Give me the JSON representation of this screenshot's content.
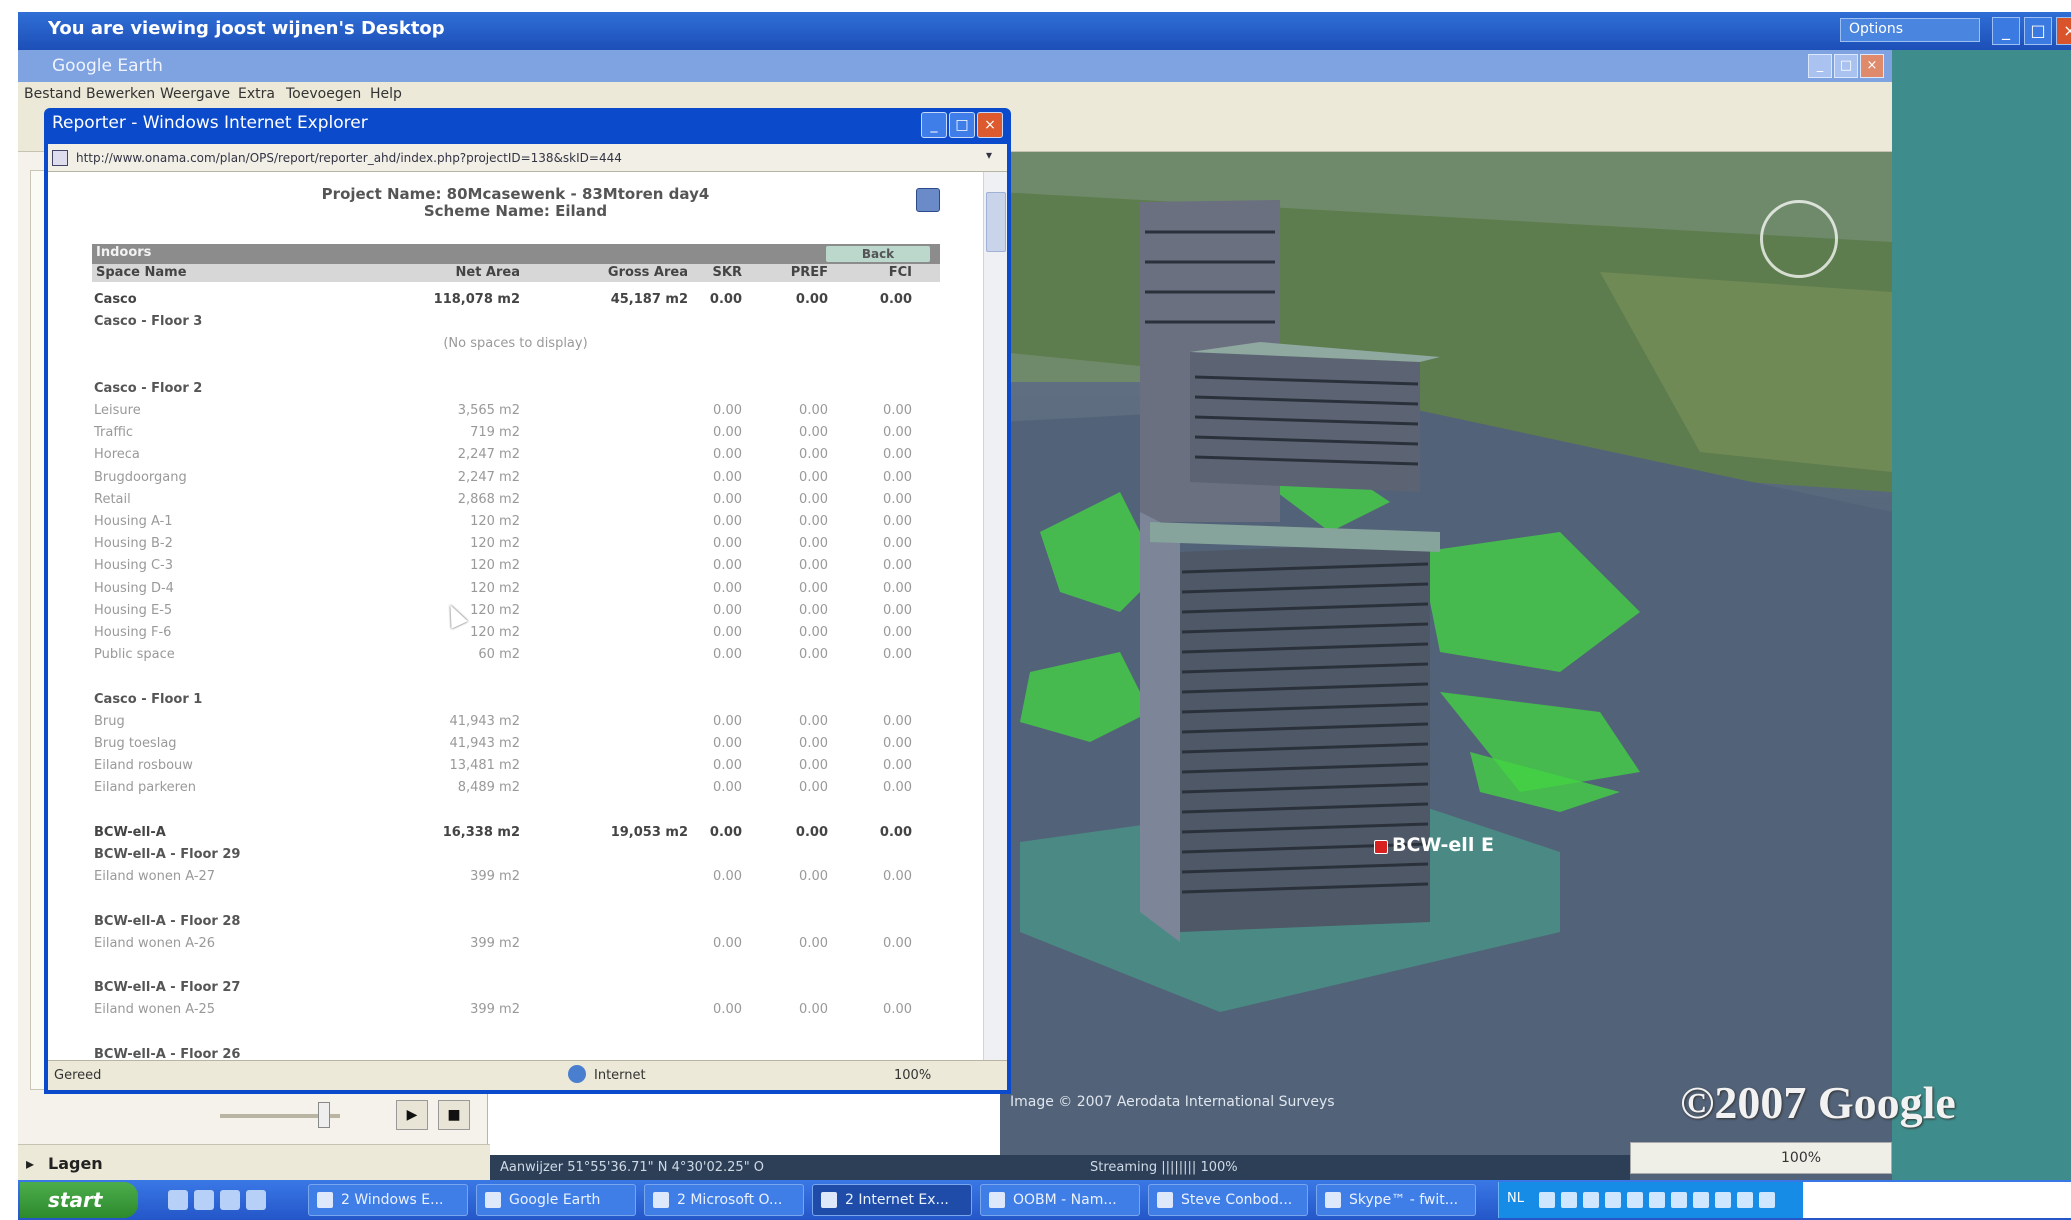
{
  "remote_desktop": {
    "title": "You are viewing joost wijnen's Desktop",
    "dropdown_label": "Options",
    "controls": [
      "_",
      "□",
      "×"
    ]
  },
  "google_earth": {
    "title": "Google Earth",
    "menu": [
      "Bestand",
      "Bewerken",
      "Weergave",
      "Extra",
      "Toevoegen",
      "Help"
    ],
    "map": {
      "placemark_label": "BCW-ell E",
      "imagery_credit": "Image © 2007 Aerodata International Surveys",
      "logo": "©2007 Google",
      "status_coords": "Aanwijzer 51°55'36.71\" N    4°30'02.25\" O",
      "status_eye": "Streaming |||||||| 100%",
      "zoom": "100%"
    },
    "layers_label": "Lagen"
  },
  "ie": {
    "title": "Reporter - Windows Internet Explorer",
    "address": "http://www.onama.com/plan/OPS/report/reporter_ahd/index.php?projectID=138&skID=444",
    "status_text": "Gereed",
    "zone": "Internet",
    "zoom": "100%"
  },
  "report": {
    "project_line": "Project Name: 80Mcasewenk - 83Mtoren day4",
    "scheme_line": "Scheme Name: Eiland",
    "bar_title": "Indoors",
    "back_label": "Back",
    "columns": [
      "Space Name",
      "Net Area",
      "Gross Area",
      "SKR",
      "PREF",
      "FCI"
    ],
    "no_spaces_text": "(No spaces to display)",
    "rows": [
      {
        "type": "bold",
        "name": "Casco",
        "net": "118,078 m2",
        "gross": "45,187 m2",
        "v1": "0.00",
        "v2": "0.00",
        "v3": "0.00"
      },
      {
        "type": "section",
        "name": "Casco - Floor 3"
      },
      {
        "type": "none"
      },
      {
        "type": "blank"
      },
      {
        "type": "section",
        "name": "Casco - Floor 2"
      },
      {
        "type": "item",
        "name": "Leisure",
        "net": "3,565 m2",
        "v1": "0.00",
        "v2": "0.00",
        "v3": "0.00"
      },
      {
        "type": "item",
        "name": "Traffic",
        "net": "719 m2",
        "v1": "0.00",
        "v2": "0.00",
        "v3": "0.00"
      },
      {
        "type": "item",
        "name": "Horeca",
        "net": "2,247 m2",
        "v1": "0.00",
        "v2": "0.00",
        "v3": "0.00"
      },
      {
        "type": "item",
        "name": "Brugdoorgang",
        "net": "2,247 m2",
        "v1": "0.00",
        "v2": "0.00",
        "v3": "0.00"
      },
      {
        "type": "item",
        "name": "Retail",
        "net": "2,868 m2",
        "v1": "0.00",
        "v2": "0.00",
        "v3": "0.00"
      },
      {
        "type": "item",
        "name": "Housing A-1",
        "net": "120 m2",
        "v1": "0.00",
        "v2": "0.00",
        "v3": "0.00"
      },
      {
        "type": "item",
        "name": "Housing B-2",
        "net": "120 m2",
        "v1": "0.00",
        "v2": "0.00",
        "v3": "0.00"
      },
      {
        "type": "item",
        "name": "Housing C-3",
        "net": "120 m2",
        "v1": "0.00",
        "v2": "0.00",
        "v3": "0.00"
      },
      {
        "type": "item",
        "name": "Housing D-4",
        "net": "120 m2",
        "v1": "0.00",
        "v2": "0.00",
        "v3": "0.00"
      },
      {
        "type": "item",
        "name": "Housing E-5",
        "net": "120 m2",
        "v1": "0.00",
        "v2": "0.00",
        "v3": "0.00"
      },
      {
        "type": "item",
        "name": "Housing F-6",
        "net": "120 m2",
        "v1": "0.00",
        "v2": "0.00",
        "v3": "0.00"
      },
      {
        "type": "item",
        "name": "Public space",
        "net": "60 m2",
        "v1": "0.00",
        "v2": "0.00",
        "v3": "0.00"
      },
      {
        "type": "blank"
      },
      {
        "type": "section",
        "name": "Casco - Floor 1"
      },
      {
        "type": "item",
        "name": "Brug",
        "net": "41,943 m2",
        "v1": "0.00",
        "v2": "0.00",
        "v3": "0.00"
      },
      {
        "type": "item",
        "name": "Brug toeslag",
        "net": "41,943 m2",
        "v1": "0.00",
        "v2": "0.00",
        "v3": "0.00"
      },
      {
        "type": "item",
        "name": "Eiland rosbouw",
        "net": "13,481 m2",
        "v1": "0.00",
        "v2": "0.00",
        "v3": "0.00"
      },
      {
        "type": "item",
        "name": "Eiland parkeren",
        "net": "8,489 m2",
        "v1": "0.00",
        "v2": "0.00",
        "v3": "0.00"
      },
      {
        "type": "blank"
      },
      {
        "type": "bold",
        "name": "BCW-ell-A",
        "net": "16,338 m2",
        "gross": "19,053 m2",
        "v1": "0.00",
        "v2": "0.00",
        "v3": "0.00"
      },
      {
        "type": "section",
        "name": "BCW-ell-A - Floor 29"
      },
      {
        "type": "item",
        "name": "Eiland wonen A-27",
        "net": "399 m2",
        "v1": "0.00",
        "v2": "0.00",
        "v3": "0.00"
      },
      {
        "type": "blank"
      },
      {
        "type": "section",
        "name": "BCW-ell-A - Floor 28"
      },
      {
        "type": "item",
        "name": "Eiland wonen A-26",
        "net": "399 m2",
        "v1": "0.00",
        "v2": "0.00",
        "v3": "0.00"
      },
      {
        "type": "blank"
      },
      {
        "type": "section",
        "name": "BCW-ell-A - Floor 27"
      },
      {
        "type": "item",
        "name": "Eiland wonen A-25",
        "net": "399 m2",
        "v1": "0.00",
        "v2": "0.00",
        "v3": "0.00"
      },
      {
        "type": "blank"
      },
      {
        "type": "section",
        "name": "BCW-ell-A - Floor 26"
      }
    ]
  },
  "taskbar": {
    "start_label": "start",
    "tasks": [
      {
        "label": "2 Windows E..."
      },
      {
        "label": "Google Earth"
      },
      {
        "label": "2 Microsoft O..."
      },
      {
        "label": "2 Internet Ex..."
      },
      {
        "label": "OOBM - Nam..."
      },
      {
        "label": "Steve Conbod..."
      },
      {
        "label": "Skype™ - fwit..."
      }
    ],
    "tray_lang": "NL"
  },
  "colors": {
    "xp_blue": "#2456c8",
    "map_green": "#4fd44f",
    "teal_bg": "#3e8d8c",
    "report_bar": "#8c8c8c"
  }
}
